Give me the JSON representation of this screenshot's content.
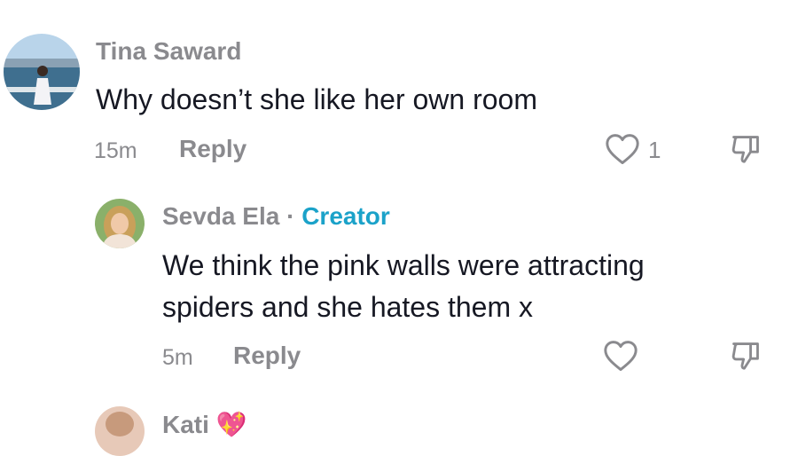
{
  "comments": [
    {
      "author": "Tina Saward",
      "text": "Why doesn’t she like her own room",
      "time": "15m",
      "reply_label": "Reply",
      "likes": "1"
    }
  ],
  "reply": {
    "author": "Sevda Ela",
    "separator": "·",
    "badge": "Creator",
    "text_line1": "We think the pink walls were attracting",
    "text_line2": "spiders and she hates them x",
    "time": "5m",
    "reply_label": "Reply"
  },
  "next_comment": {
    "author_partial": "Kati",
    "emoji": "💖"
  },
  "colors": {
    "text": "#161823",
    "muted": "#8a8a8e",
    "creator_badge": "#1ba2c9"
  },
  "icons": {
    "like": "heart-outline-icon",
    "dislike": "thumbs-down-icon"
  }
}
